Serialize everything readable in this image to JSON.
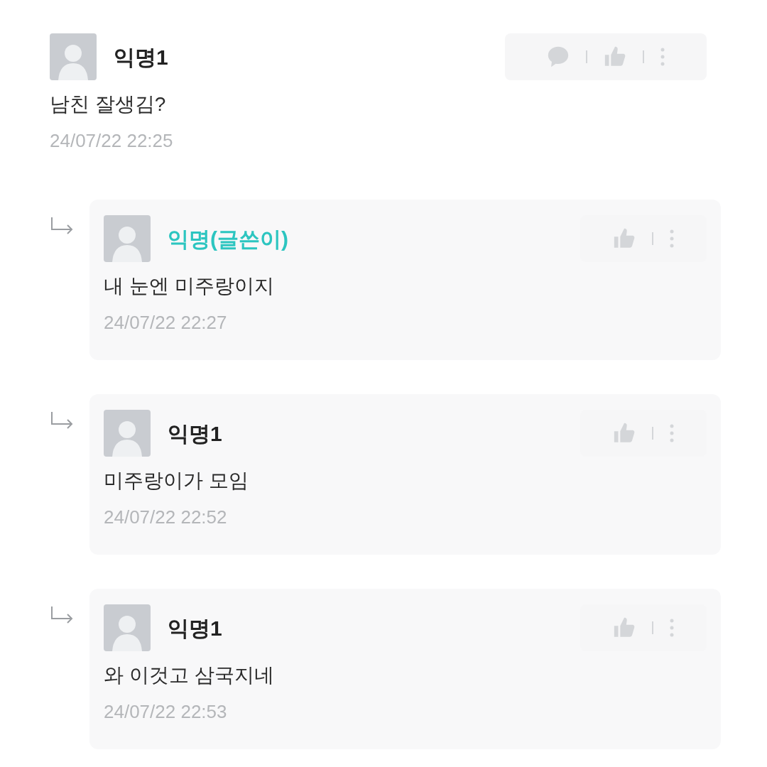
{
  "comments": [
    {
      "kind": "comment",
      "author": "익명1",
      "is_author": false,
      "text": "남친 잘생김?",
      "time": "24/07/22 22:25"
    },
    {
      "kind": "reply",
      "author": "익명(글쓴이)",
      "is_author": true,
      "text": "내 눈엔 미주랑이지",
      "time": "24/07/22 22:27"
    },
    {
      "kind": "reply",
      "author": "익명1",
      "is_author": false,
      "text": "미주랑이가 모임",
      "time": "24/07/22 22:52"
    },
    {
      "kind": "reply",
      "author": "익명1",
      "is_author": false,
      "text": "와 이것고 삼국지네",
      "time": "24/07/22 22:53"
    }
  ]
}
